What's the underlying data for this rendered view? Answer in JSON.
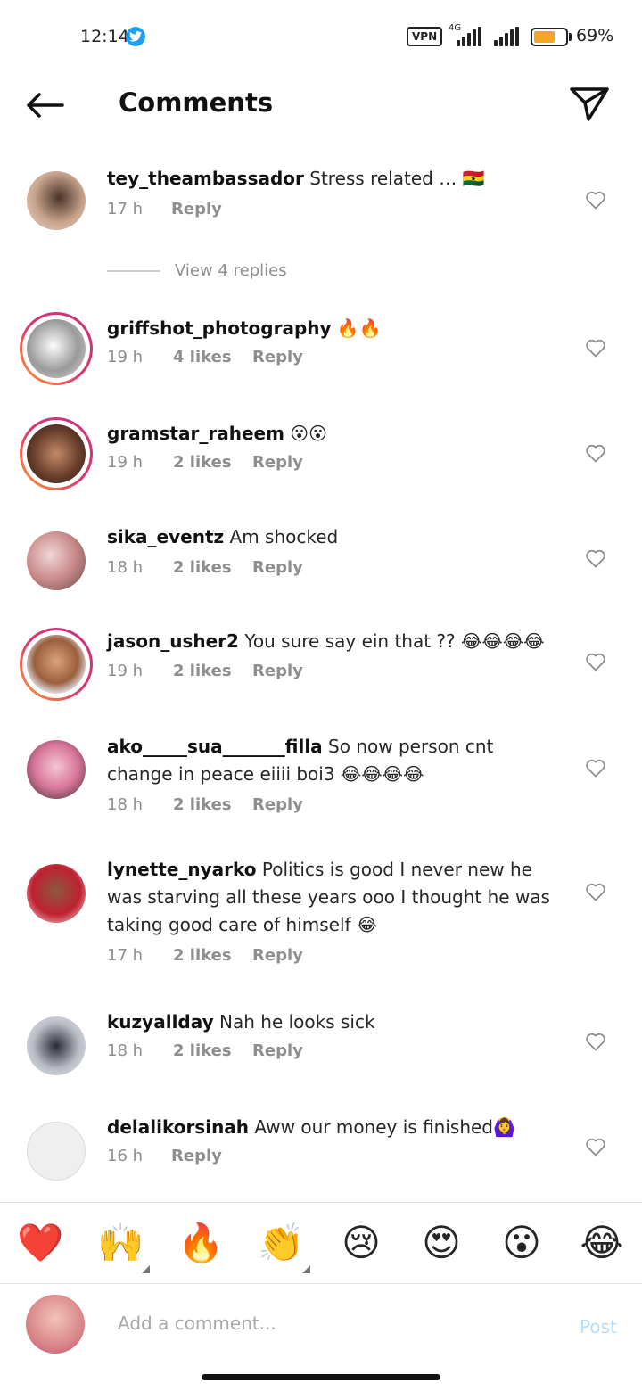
{
  "status": {
    "time": "12:14",
    "vpn": "VPN",
    "network": "4G",
    "battery": "69%",
    "battery_level": 0.69
  },
  "header": {
    "title": "Comments"
  },
  "comments": [
    {
      "user": "tey_theambassador",
      "text": "Stress related … 🇬🇭",
      "time": "17 h",
      "likes": "",
      "reply": "Reply"
    },
    {
      "user": "griffshot_photography",
      "text": "🔥🔥",
      "time": "19 h",
      "likes": "4 likes",
      "reply": "Reply"
    },
    {
      "user": "gramstar_raheem",
      "text": "😮😮",
      "time": "19 h",
      "likes": "2 likes",
      "reply": "Reply"
    },
    {
      "user": "sika_eventz",
      "text": "Am shocked",
      "time": "18 h",
      "likes": "2 likes",
      "reply": "Reply"
    },
    {
      "user": "jason_usher2",
      "text": "You sure say ein that ?? 😂😂😂😂",
      "time": "19 h",
      "likes": "2 likes",
      "reply": "Reply"
    },
    {
      "user": "ako_____sua_______filla",
      "text": "So now person cnt change in peace eiiii boi3 😂😂😂😂",
      "time": "18 h",
      "likes": "2 likes",
      "reply": "Reply"
    },
    {
      "user": "lynette_nyarko",
      "text": "Politics is good I never new he was starving all these years ooo I thought he was taking good care of himself 😂",
      "time": "17 h",
      "likes": "2 likes",
      "reply": "Reply"
    },
    {
      "user": "kuzyallday",
      "text": "Nah he looks sick",
      "time": "18 h",
      "likes": "2 likes",
      "reply": "Reply"
    },
    {
      "user": "delalikorsinah",
      "text": "Aww our money is finished🙆‍♀️",
      "time": "16 h",
      "likes": "",
      "reply": "Reply"
    }
  ],
  "view_replies": "View 4 replies",
  "emoji_bar": [
    "❤️",
    "🙌",
    "🔥",
    "👏",
    "😢",
    "😍",
    "😮",
    "😂"
  ],
  "composer": {
    "placeholder": "Add a comment...",
    "post_label": "Post"
  },
  "colors": {
    "story_ring": "#E1306C",
    "post_disabled": "#b2dffc",
    "twitter": "#1DA1F2",
    "battery": "#F5A623"
  }
}
